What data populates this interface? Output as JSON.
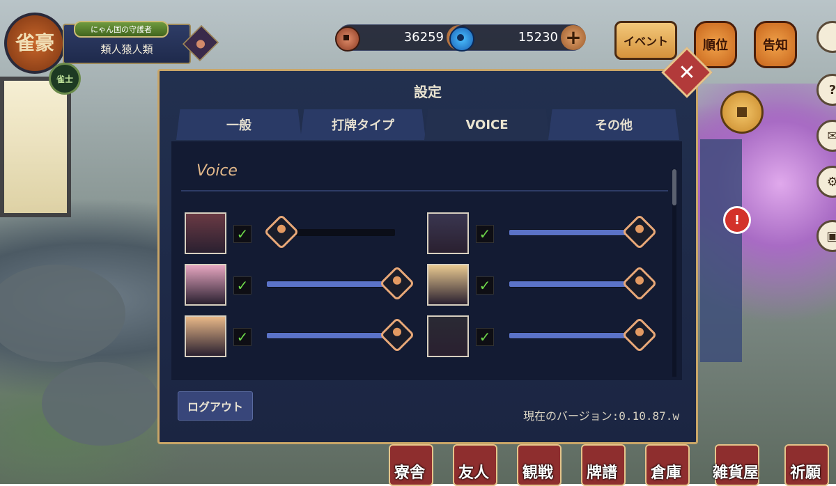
{
  "profile": {
    "emblem_text": "雀豪",
    "rank_badge_text": "雀士",
    "title_banner": "にゃん国の守護者",
    "player_name": "類人猿人類"
  },
  "currencies": [
    {
      "name": "copper-coin",
      "value": "36259"
    },
    {
      "name": "jade",
      "value": "15230"
    }
  ],
  "top_buttons": {
    "event": "イベント",
    "ranking": "順位",
    "notice": "告知"
  },
  "dialog": {
    "title": "設定",
    "tabs": [
      {
        "label": "一般",
        "active": false
      },
      {
        "label": "打牌タイプ",
        "active": false
      },
      {
        "label": "VOICE",
        "active": true
      },
      {
        "label": "その他",
        "active": false
      }
    ],
    "section_title": "Voice",
    "voices": [
      {
        "checked": true,
        "volume": 0.1
      },
      {
        "checked": true,
        "volume": 1.0
      },
      {
        "checked": true,
        "volume": 1.0
      },
      {
        "checked": true,
        "volume": 1.0
      },
      {
        "checked": true,
        "volume": 1.0
      },
      {
        "checked": true,
        "volume": 1.0
      }
    ],
    "logout_label": "ログアウト",
    "version": "現在のバージョン:0.10.87.w"
  },
  "bottom_nav": [
    {
      "label": "寮舎"
    },
    {
      "label": "友人"
    },
    {
      "label": "観戦"
    },
    {
      "label": "牌譜"
    },
    {
      "label": "倉庫"
    },
    {
      "label": "雑貨屋"
    },
    {
      "label": "祈願"
    }
  ],
  "colors": {
    "dialog_border": "#c9a668",
    "slider_fill": "#5b73c8",
    "check_mark": "#6ed84a",
    "accent_orange": "#e39a62"
  }
}
